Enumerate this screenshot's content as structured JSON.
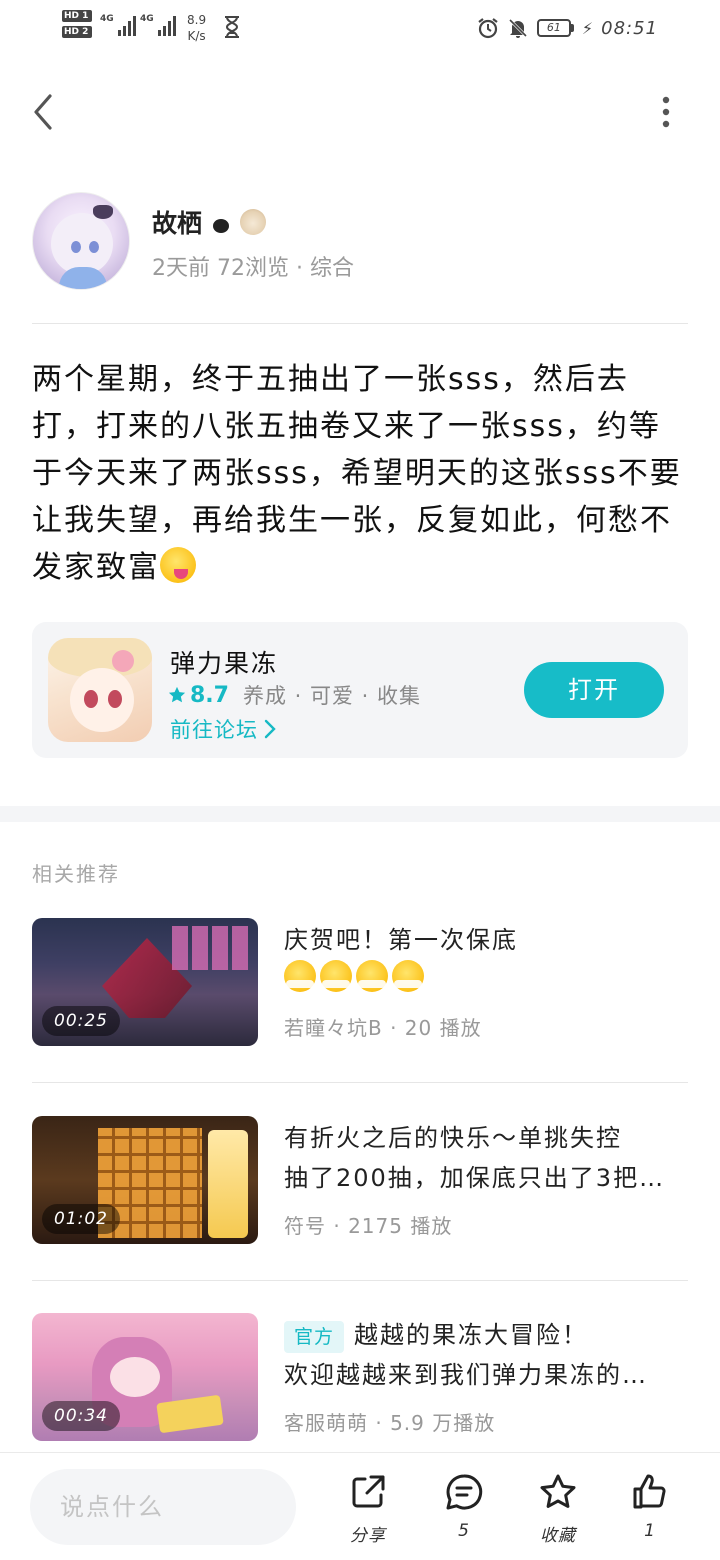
{
  "status_bar": {
    "hd1": "HD 1",
    "hd2": "HD 2",
    "net1": "4G",
    "net2": "4G",
    "speed_value": "8.9",
    "speed_unit": "K/s",
    "battery": "61",
    "time": "08:51",
    "icons": [
      "alarm-icon",
      "mute-icon",
      "battery-icon",
      "charging-icon",
      "hourglass-icon"
    ]
  },
  "nav": {
    "back_icon": "chevron-left-icon",
    "more_icon": "more-vertical-icon"
  },
  "author": {
    "name": "故栖",
    "meta": "2天前 72浏览 · 综合"
  },
  "post": {
    "text": "两个星期，终于五抽出了一张sss，然后去打，打来的八张五抽卷又来了一张sss，约等于今天来了两张sss，希望明天的这张sss不要让我失望，再给我生一张，反复如此，何愁不发家致富"
  },
  "game_card": {
    "name": "弹力果冻",
    "score": "8.7",
    "tags": "养成 · 可爱 · 收集",
    "forum_link": "前往论坛",
    "open_button": "打开",
    "accent_color": "#17bcc8"
  },
  "recommendations": {
    "heading": "相关推荐",
    "items": [
      {
        "title_line1": "庆贺吧！第一次保底",
        "title_line2": "",
        "duration": "00:25",
        "meta": "若瞳々坑B · 20 播放",
        "official": ""
      },
      {
        "title_line1": "有折火之后的快乐～单挑失控",
        "title_line2": "抽了200抽，加保底只出了3把…",
        "duration": "01:02",
        "meta": "符号 · 2175 播放",
        "official": ""
      },
      {
        "title_line1": "越越的果冻大冒险！",
        "title_line2": "欢迎越越来到我们弹力果冻的…",
        "duration": "00:34",
        "meta": "客服萌萌 · 5.9 万播放",
        "official": "官方"
      }
    ]
  },
  "bottom_bar": {
    "comment_placeholder": "说点什么",
    "share_label": "分享",
    "comment_count": "5",
    "favorite_label": "收藏",
    "like_count": "1"
  }
}
